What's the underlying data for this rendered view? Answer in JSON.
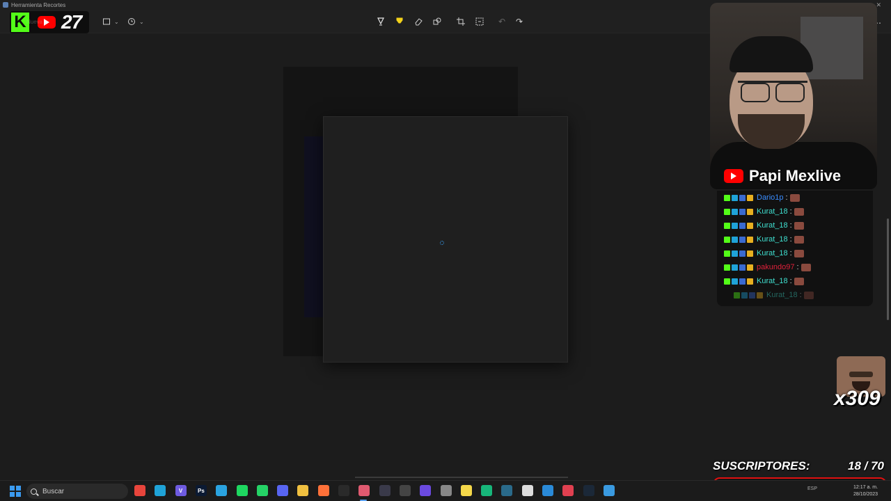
{
  "window": {
    "title": "Herramienta Recortes",
    "close_glyph": "✕"
  },
  "toolbar": {
    "new_label": "Nueva",
    "mode_icon": "rectangle-snip-icon",
    "delay_icon": "clock-icon",
    "tools": [
      {
        "name": "ballpoint-pen-icon",
        "glyph": "▽"
      },
      {
        "name": "highlighter-icon",
        "glyph": "▼"
      },
      {
        "name": "eraser-icon",
        "glyph": "◇"
      },
      {
        "name": "shapes-icon",
        "glyph": "▢"
      },
      {
        "name": "crop-icon",
        "glyph": "⌗"
      },
      {
        "name": "text-actions-icon",
        "glyph": "⌘"
      },
      {
        "name": "undo-icon",
        "glyph": "↶"
      },
      {
        "name": "redo-icon",
        "glyph": "↷"
      }
    ],
    "more_glyph": "…"
  },
  "overlay": {
    "kick_letter": "K",
    "counter": "27"
  },
  "stream": {
    "channel_name": "Papi Mexlive",
    "multiplier": "x309",
    "subs_label": "SUSCRIPTORES:",
    "subs_count": "18 / 70",
    "subs_progress": 0.257
  },
  "chat": [
    {
      "user": "Dario1p",
      "color": "#3a8dff",
      "colon": ":"
    },
    {
      "user": "Kurat_18",
      "color": "#3fe0d0",
      "colon": ":"
    },
    {
      "user": "Kurat_18",
      "color": "#3fe0d0",
      "colon": ":"
    },
    {
      "user": "Kurat_18",
      "color": "#3fe0d0",
      "colon": ":"
    },
    {
      "user": "Kurat_18",
      "color": "#3fe0d0",
      "colon": ":"
    },
    {
      "user": "pakundo97",
      "color": "#e0203a",
      "colon": ":"
    },
    {
      "user": "Kurat_18",
      "color": "#3fe0d0",
      "colon": ":"
    },
    {
      "user": "Kurat_18",
      "color": "#3fe0d0",
      "colon": ":"
    }
  ],
  "taskbar": {
    "search_placeholder": "Buscar",
    "apps": [
      {
        "name": "chrome-icon",
        "color": "#e8453c",
        "label": ""
      },
      {
        "name": "edge-icon",
        "color": "#1fa3d8",
        "label": ""
      },
      {
        "name": "vivaldi-icon",
        "color": "#6e5be0",
        "label": "V"
      },
      {
        "name": "photoshop-icon",
        "color": "#0b1a33",
        "label": "Ps"
      },
      {
        "name": "telegram-icon",
        "color": "#2aa3e0",
        "label": ""
      },
      {
        "name": "spotify-icon",
        "color": "#1ed760",
        "label": ""
      },
      {
        "name": "whatsapp-icon",
        "color": "#25d366",
        "label": ""
      },
      {
        "name": "discord-icon",
        "color": "#5865f2",
        "label": ""
      },
      {
        "name": "file-explorer-icon",
        "color": "#f0c040",
        "label": ""
      },
      {
        "name": "firefox-icon",
        "color": "#ff7139",
        "label": ""
      },
      {
        "name": "epic-games-icon",
        "color": "#2a2a2a",
        "label": ""
      },
      {
        "name": "snipping-tool-icon",
        "color": "#e05a70",
        "label": ""
      },
      {
        "name": "obs-icon",
        "color": "#3a3a4a",
        "label": ""
      },
      {
        "name": "davinci-icon",
        "color": "#444",
        "label": ""
      },
      {
        "name": "cortana-icon",
        "color": "#6b4ae0",
        "label": ""
      },
      {
        "name": "qr-app-icon",
        "color": "#888",
        "label": ""
      },
      {
        "name": "sticky-notes-icon",
        "color": "#f5d84a",
        "label": ""
      },
      {
        "name": "app-green-icon",
        "color": "#17b67a",
        "label": ""
      },
      {
        "name": "fish-app-icon",
        "color": "#2a6a8a",
        "label": ""
      },
      {
        "name": "git-icon",
        "color": "#dddddd",
        "label": ""
      },
      {
        "name": "vscode-icon",
        "color": "#2a8ad8",
        "label": ""
      },
      {
        "name": "valorant-icon",
        "color": "#e04050",
        "label": ""
      },
      {
        "name": "steam-icon",
        "color": "#1b2838",
        "label": ""
      },
      {
        "name": "remote-app-icon",
        "color": "#3a9ae0",
        "label": ""
      }
    ],
    "tray_lang": "ESP",
    "time": "12:17 a. m.",
    "date": "28/10/2023"
  }
}
